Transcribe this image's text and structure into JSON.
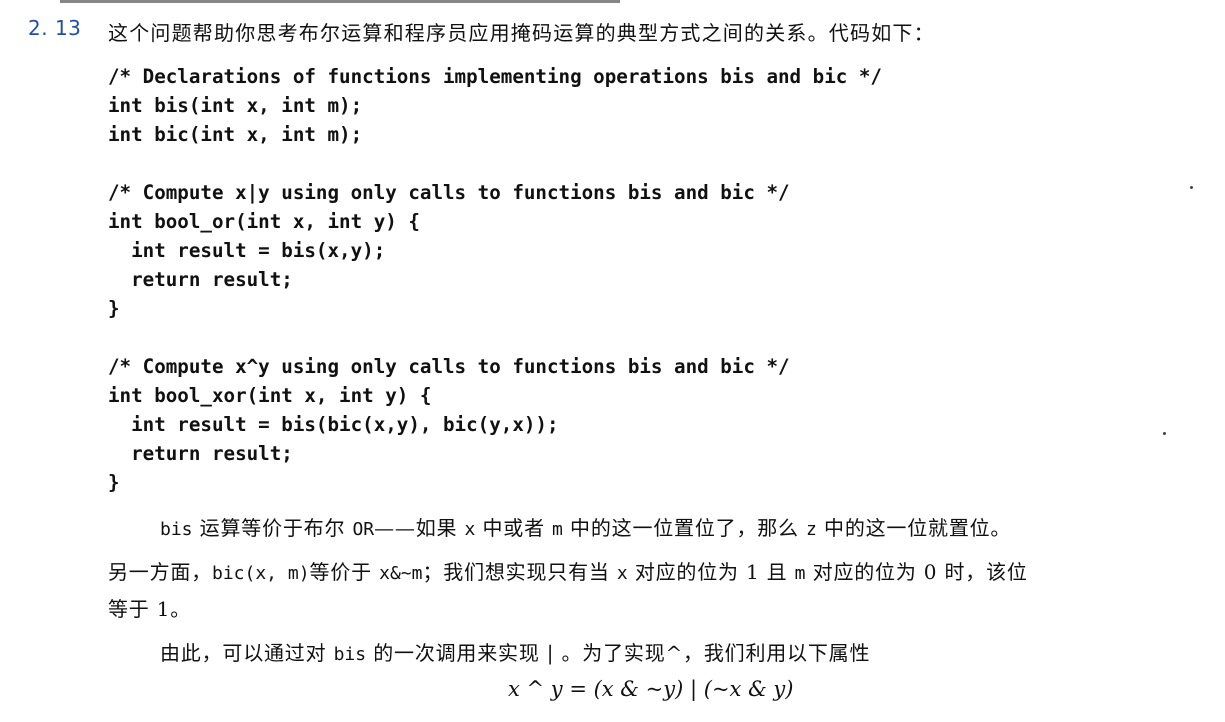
{
  "problem": {
    "number": "2. 13",
    "intro": "这个问题帮助你思考布尔运算和程序员应用掩码运算的典型方式之间的关系。代码如下："
  },
  "code_lines": [
    "/* Declarations of functions implementing operations bis and bic */",
    "int bis(int x, int m);",
    "int bic(int x, int m);",
    "",
    "/* Compute x|y using only calls to functions bis and bic */",
    "int bool_or(int x, int y) {",
    "  int result = bis(x,y);",
    "  return result;",
    "}",
    "",
    "/* Compute x^y using only calls to functions bis and bic */",
    "int bool_xor(int x, int y) {",
    "  int result = bis(bic(x,y), bic(y,x));",
    "  return result;",
    "}"
  ],
  "paragraph1": {
    "line1": {
      "code_bis": "bis",
      "t1": " 运算等价于布尔 ",
      "code_or": "OR",
      "t2": "——如果 ",
      "code_x": "x",
      "t3": " 中或者 ",
      "code_m": "m",
      "t4": " 中的这一位置位了，那么 ",
      "code_z": "z",
      "t5": " 中的这一位就置位。"
    },
    "line2": {
      "t1": "另一方面，",
      "code_bic": "bic(x, m)",
      "t2": "等价于 ",
      "code_expr": "x&~m",
      "t3": "；我们想实现只有当 ",
      "code_x": "x",
      "t4": " 对应的位为 1 且 ",
      "code_m": "m",
      "t5": " 对应的位为 0 时，该位"
    },
    "line3": "等于 1。"
  },
  "paragraph2": {
    "t1": "由此，可以通过对 ",
    "code_bis": "bis",
    "t2": " 的一次调用来实现 | 。为了实现^，我们利用以下属性"
  },
  "formula": "x ^ y = (x & ~y) | (~x & y)"
}
